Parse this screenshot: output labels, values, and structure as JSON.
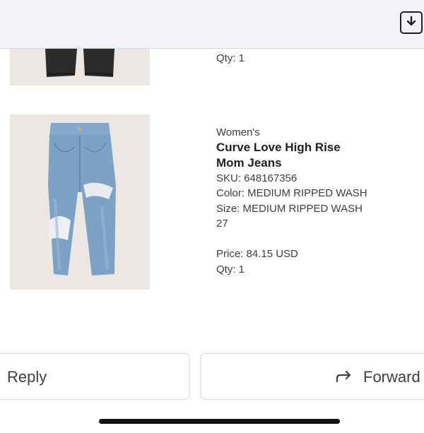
{
  "topbar": {
    "action_icon": "download-tray-icon"
  },
  "items": [
    {
      "qty": "Qty: 1"
    },
    {
      "category": "Women's",
      "name_line1": "Curve Love High Rise",
      "name_line2": "Mom Jeans",
      "sku": "SKU: 648167356",
      "color": "Color: MEDIUM RIPPED WASH",
      "size_line1": "Size: MEDIUM RIPPED WASH",
      "size_line2": "27",
      "price": "Price: 84.15 USD",
      "qty": "Qty: 1"
    }
  ],
  "actions": {
    "reply_label": "Reply",
    "forward_label": "Forward"
  },
  "colors": {
    "topbar_bg": "#f1f3f9",
    "thumb_bg": "#ece7e2",
    "denim": "#7ea1c6"
  }
}
